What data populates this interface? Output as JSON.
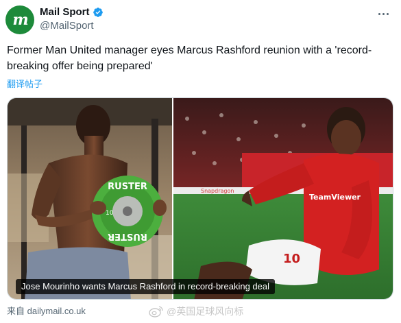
{
  "account": {
    "display_name": "Mail Sport",
    "handle": "@MailSport",
    "avatar_text": "m",
    "verified": true
  },
  "tweet": {
    "text": "Former Man United manager eyes Marcus Rashford reunion with a 'record-breaking offer being prepared'",
    "translate_label": "翻译帖子"
  },
  "card": {
    "caption": "Jose Mourinho wants Marcus Rashford in record-breaking deal",
    "left_image": "man-lifting-weight-plate-photo",
    "right_image": "football-player-knee-slide-celebration-photo",
    "plate_text_top": "RUSTER",
    "plate_text_bottom": "RUSTER",
    "plate_weight": "10",
    "shirt_sponsor": "TeamViewer",
    "shirt_number": "10",
    "ad_board_text": "Snapdragon"
  },
  "source": {
    "prefix": "来自",
    "domain": "dailymail.co.uk"
  },
  "watermark": {
    "text": "@英国足球风向标",
    "icon": "weibo-icon"
  },
  "colors": {
    "brand_green": "#1d8a3a",
    "verified_blue": "#1d9bf0",
    "link_blue": "#1d9bf0",
    "secondary_text": "#536471"
  }
}
